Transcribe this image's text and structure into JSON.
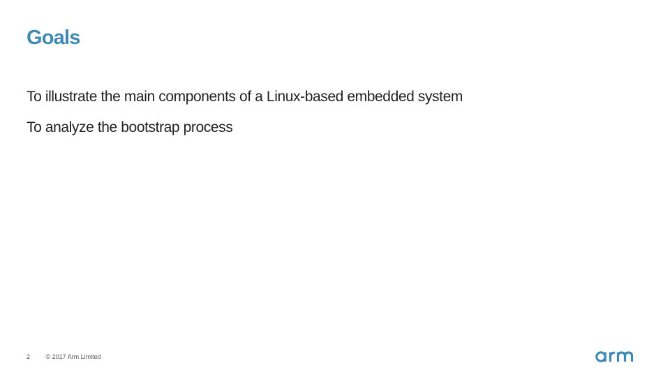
{
  "slide": {
    "title": "Goals",
    "bullets": [
      "To illustrate the main components of a Linux-based embedded system",
      "To analyze the bootstrap process"
    ]
  },
  "footer": {
    "page_number": "2",
    "copyright": "© 2017 Arm Limited"
  },
  "logo": {
    "text": "arm",
    "color": "#3e8ab5"
  },
  "colors": {
    "title": "#3e8ab5",
    "body_text": "#222222",
    "background": "#ffffff"
  }
}
